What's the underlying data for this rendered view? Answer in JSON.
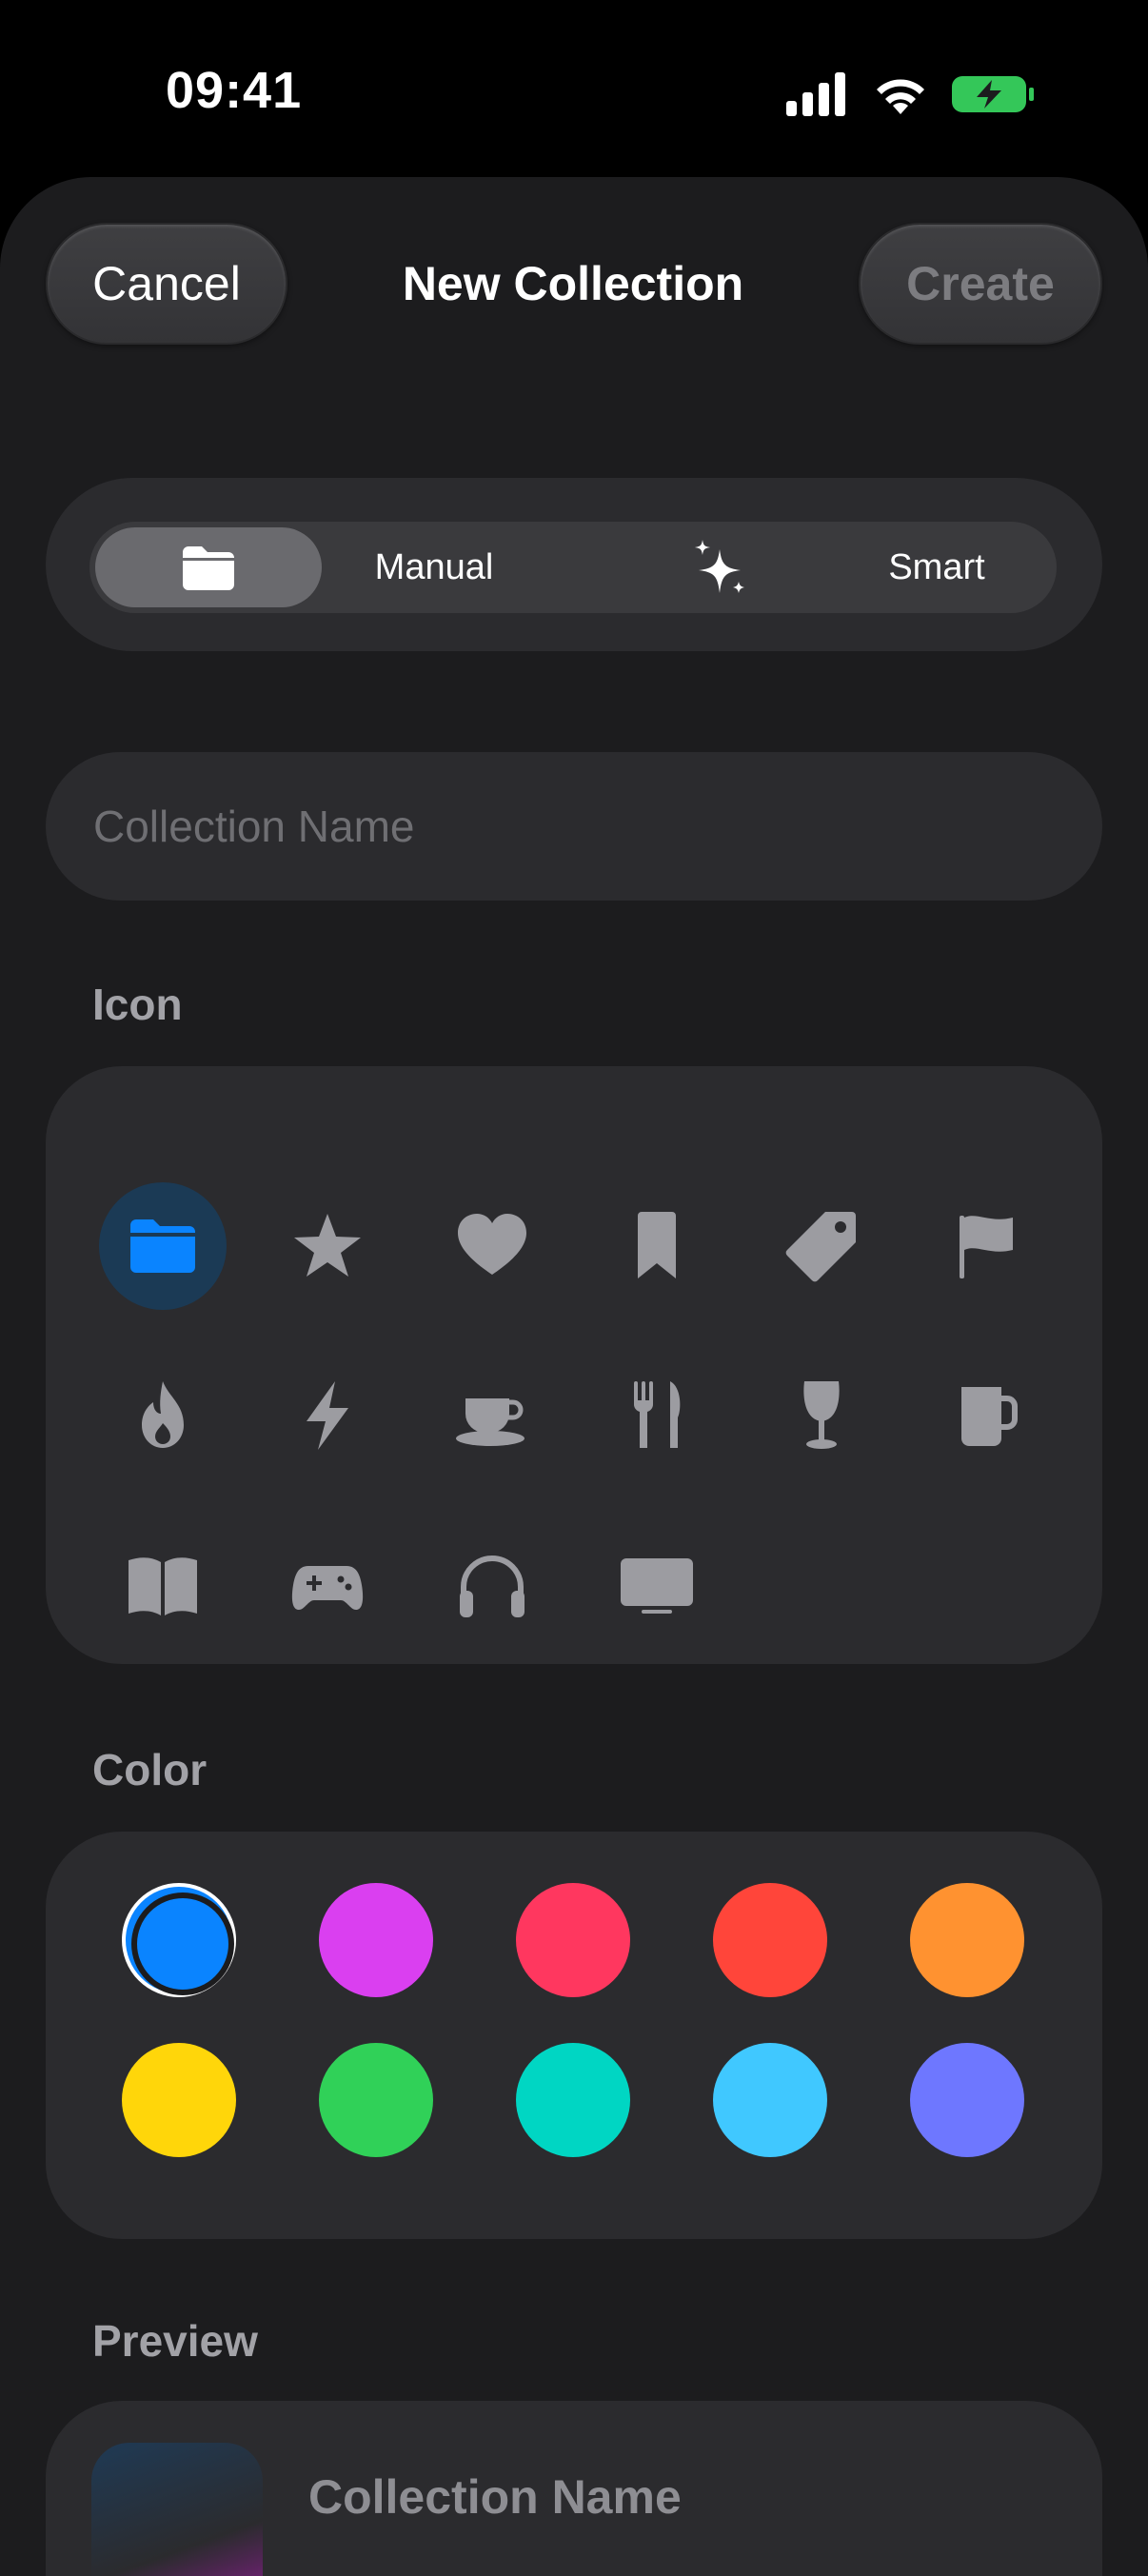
{
  "status": {
    "time": "09:41"
  },
  "header": {
    "cancel_label": "Cancel",
    "title": "New Collection",
    "create_label": "Create"
  },
  "segment": {
    "manual_label": "Manual",
    "smart_label": "Smart",
    "selected": "manual"
  },
  "name_field": {
    "placeholder": "Collection Name",
    "value": ""
  },
  "icon_section": {
    "label": "Icon",
    "icons": [
      "folder-icon",
      "star-icon",
      "heart-icon",
      "bookmark-icon",
      "tag-icon",
      "flag-icon",
      "flame-icon",
      "bolt-icon",
      "cup-saucer-icon",
      "fork-knife-icon",
      "wineglass-icon",
      "mug-icon",
      "book-icon",
      "gamecontroller-icon",
      "headphones-icon",
      "tv-icon"
    ],
    "selected": "folder-icon",
    "accent": "#0a84ff"
  },
  "color_section": {
    "label": "Color",
    "swatches": [
      "#0a84ff",
      "#da3ff0",
      "#ff375f",
      "#ff453a",
      "#ff9230",
      "#ffd60a",
      "#30d158",
      "#00d6c3",
      "#40c8ff",
      "#6e77ff"
    ],
    "selected_index": 0
  },
  "preview_section": {
    "label": "Preview",
    "name": "Collection Name"
  },
  "colors": {
    "battery": "#34c759",
    "icon_gray": "#9c9ca1"
  }
}
